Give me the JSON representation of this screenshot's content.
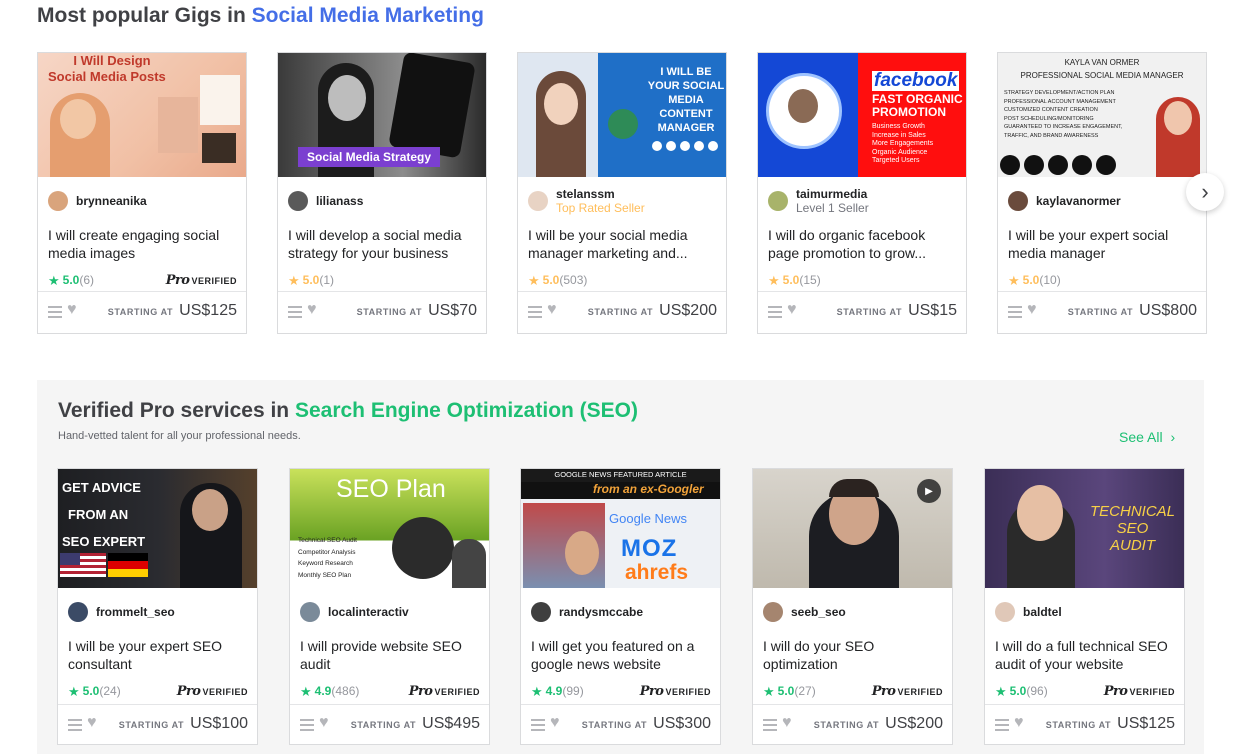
{
  "section1": {
    "title_prefix": "Most popular Gigs in ",
    "title_accent": "Social Media Marketing",
    "cards": [
      {
        "username": "brynneanika",
        "level": "",
        "title": "I will create engaging social media images",
        "rating": "5.0",
        "count": "(6)",
        "pro": true,
        "starting": "STARTING AT",
        "price": "US$125",
        "thumb_text": [
          "I Will Design",
          "Social Media Posts"
        ]
      },
      {
        "username": "lilianass",
        "level": "",
        "title": "I will develop a social media strategy for your business",
        "rating": "5.0",
        "count": "(1)",
        "pro": false,
        "starting": "STARTING AT",
        "price": "US$70",
        "thumb_text": [
          "Social Media Strategy"
        ]
      },
      {
        "username": "stelanssm",
        "level": "Top Rated Seller",
        "title": "I will be your social media manager marketing and...",
        "rating": "5.0",
        "count": "(503)",
        "pro": false,
        "starting": "STARTING AT",
        "price": "US$200",
        "thumb_text": [
          "I WILL BE",
          "YOUR SOCIAL",
          "MEDIA",
          "CONTENT",
          "MANAGER"
        ]
      },
      {
        "username": "taimurmedia",
        "level": "Level 1 Seller",
        "title": "I will do organic facebook page promotion to grow...",
        "rating": "5.0",
        "count": "(15)",
        "pro": false,
        "starting": "STARTING AT",
        "price": "US$15",
        "thumb_text": [
          "facebook",
          "FAST ORGANIC",
          "PROMOTION",
          "Business Growth",
          "Increase in Sales",
          "More Engagements",
          "Organic Audience",
          "Targeted Users"
        ]
      },
      {
        "username": "kaylavanormer",
        "level": "",
        "title": "I will be your expert social media manager",
        "rating": "5.0",
        "count": "(10)",
        "pro": false,
        "starting": "STARTING AT",
        "price": "US$800",
        "thumb_text": [
          "KAYLA VAN ORMER",
          "PROFESSIONAL SOCIAL MEDIA MANAGER",
          "STRATEGY DEVELOPMENT/ACTION PLAN",
          "PROFESSIONAL ACCOUNT MANAGEMENT",
          "CUSTOMIZED CONTENT CREATION",
          "POST SCHEDULING/MONITORING",
          "GUARANTEED TO INCREASE ENGAGEMENT,",
          "TRAFFIC, AND BRAND AWARENESS"
        ]
      }
    ],
    "next_icon": "›"
  },
  "section2": {
    "title_prefix": "Verified Pro services in ",
    "title_accent": "Search Engine Optimization (SEO)",
    "subtitle": "Hand-vetted talent for all your professional needs.",
    "see_all": "See All",
    "see_all_icon": "›",
    "cards": [
      {
        "username": "frommelt_seo",
        "title": "I will be your expert SEO consultant",
        "rating": "5.0",
        "count": "(24)",
        "starting": "STARTING AT",
        "price": "US$100",
        "thumb_text": [
          "GET ADVICE",
          "FROM AN",
          "SEO EXPERT"
        ]
      },
      {
        "username": "localinteractiv",
        "title": "I will provide website SEO audit",
        "rating": "4.9",
        "count": "(486)",
        "starting": "STARTING AT",
        "price": "US$495",
        "thumb_text": [
          "SEO Plan",
          "Technical SEO Audit",
          "Competitor Analysis",
          "Keyword Research",
          "Monthly SEO Plan"
        ]
      },
      {
        "username": "randysmccabe",
        "title": "I will get you featured on a google news website",
        "rating": "4.9",
        "count": "(99)",
        "starting": "STARTING AT",
        "price": "US$300",
        "thumb_text": [
          "GOOGLE NEWS FEATURED ARTICLE",
          "from an ex-Googler",
          "Google News",
          "MOZ",
          "ahrefs"
        ]
      },
      {
        "username": "seeb_seo",
        "title": "I will do your SEO optimization",
        "rating": "5.0",
        "count": "(27)",
        "starting": "STARTING AT",
        "price": "US$200",
        "thumb_text": []
      },
      {
        "username": "baldtel",
        "title": "I will do a full technical SEO audit of your website",
        "rating": "5.0",
        "count": "(96)",
        "starting": "STARTING AT",
        "price": "US$125",
        "thumb_text": [
          "TECHNICAL",
          "SEO",
          "AUDIT"
        ]
      }
    ]
  },
  "pro_badge": {
    "word": "Pro",
    "verified": "VERIFIED"
  },
  "colors": {
    "section1_accent": "#446ee7",
    "section2_accent": "#1dbf73",
    "star_gold": "#ffbe5b",
    "top_rated": "#ffbe5b"
  }
}
